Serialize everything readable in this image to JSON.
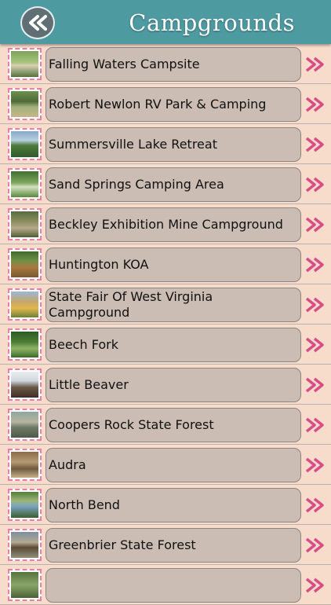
{
  "header": {
    "title": "Campgrounds",
    "back_icon": "double-chevron-left-icon",
    "color": "#4d9aa0"
  },
  "list": {
    "row_icon": "double-chevron-right-icon",
    "chevron_color": "#d94d86",
    "items": [
      {
        "label": "Falling Waters Campsite"
      },
      {
        "label": "Robert Newlon RV Park & Camping"
      },
      {
        "label": "Summersville Lake Retreat"
      },
      {
        "label": "Sand Springs Camping Area"
      },
      {
        "label": "Beckley Exhibition Mine Campground"
      },
      {
        "label": "Huntington KOA"
      },
      {
        "label": "State Fair Of West Virginia Campground"
      },
      {
        "label": "Beech Fork"
      },
      {
        "label": "Little Beaver"
      },
      {
        "label": "Coopers Rock State Forest"
      },
      {
        "label": "Audra"
      },
      {
        "label": "North Bend"
      },
      {
        "label": "Greenbrier State Forest"
      },
      {
        "label": ""
      }
    ]
  }
}
